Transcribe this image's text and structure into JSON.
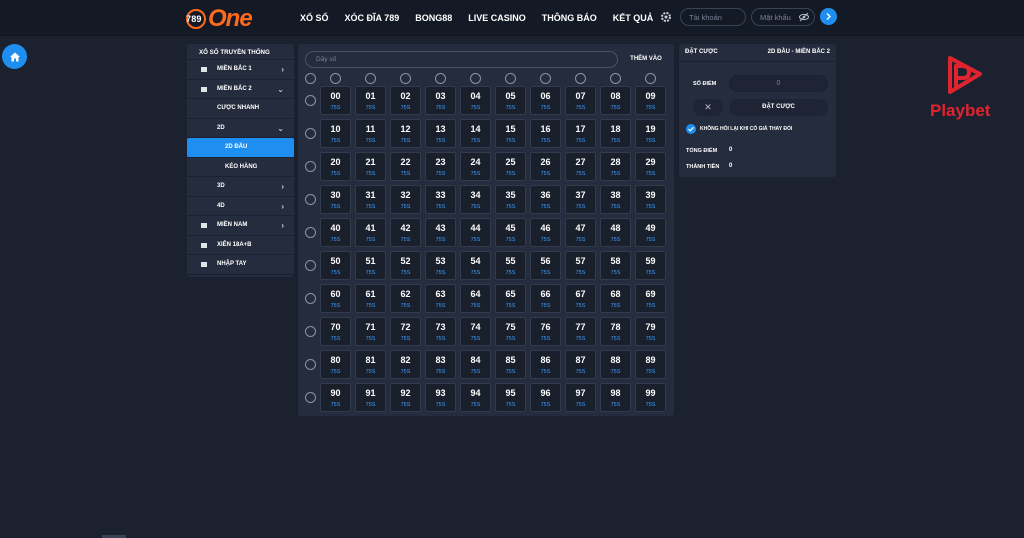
{
  "header": {
    "logo": {
      "digits": "789",
      "word": "One"
    },
    "nav": [
      "XỔ SỐ",
      "XÓC ĐĨA 789",
      "BONG88",
      "LIVE CASINO",
      "THÔNG BÁO",
      "KẾT QUẢ"
    ],
    "username_placeholder": "Tài khoản",
    "password_placeholder": "Mật khẩu",
    "login_icon": "arrow-right-icon",
    "settings_icon": "gear-icon",
    "eye_icon": "eye-off-icon"
  },
  "home_icon": "home-icon",
  "sidebar": {
    "title": "XỔ SỐ TRUYỀN THỐNG",
    "items": [
      {
        "label": "MIỀN BẮC 1",
        "chevron": "›",
        "level": 0,
        "icon": true
      },
      {
        "label": "MIỀN BẮC 2",
        "chevron": "⌄",
        "level": 0,
        "icon": true
      },
      {
        "label": "CƯỢC NHANH",
        "chevron": "",
        "level": 1,
        "icon": false
      },
      {
        "label": "2D",
        "chevron": "⌄",
        "level": 1,
        "icon": false
      },
      {
        "label": "2D ĐẦU",
        "chevron": "",
        "level": 2,
        "icon": false,
        "active": true
      },
      {
        "label": "KÉO HÀNG",
        "chevron": "",
        "level": 2,
        "icon": false
      },
      {
        "label": "3D",
        "chevron": "›",
        "level": 1,
        "icon": false
      },
      {
        "label": "4D",
        "chevron": "›",
        "level": 1,
        "icon": false
      },
      {
        "label": "MIỀN NAM",
        "chevron": "›",
        "level": 0,
        "icon": true
      },
      {
        "label": "XIÊN 18A+B",
        "chevron": "",
        "level": 0,
        "icon": true
      },
      {
        "label": "NHẬP TAY",
        "chevron": "",
        "level": 0,
        "icon": true
      }
    ]
  },
  "grid": {
    "input_placeholder": "Dãy số",
    "add_label": "THÊM VÀO",
    "odds": "75S",
    "rows": 10,
    "cols": 10
  },
  "bet": {
    "title": "ĐẶT CƯỢC",
    "subtitle": "2D ĐẦU - MIỀN BẮC 2",
    "points_label": "SỐ ĐIỂM",
    "points_value": "0",
    "clear_label": "✕",
    "place_label": "ĐẶT CƯỢC",
    "confirm_label": "KHÔNG HỎI LẠI KHI CÓ GIÁ THAY ĐỔI",
    "confirm_checked": true,
    "total_points_label": "TỔNG ĐIỂM",
    "total_points_value": "0",
    "total_money_label": "THÀNH TIỀN",
    "total_money_value": "0"
  },
  "watermark": {
    "brand": "Playbet",
    "color": "#e0242f"
  },
  "colors": {
    "accent": "#1e8ff0",
    "bg": "#1c2130",
    "panel": "#252c3d",
    "logo": "#ff6a1a"
  }
}
